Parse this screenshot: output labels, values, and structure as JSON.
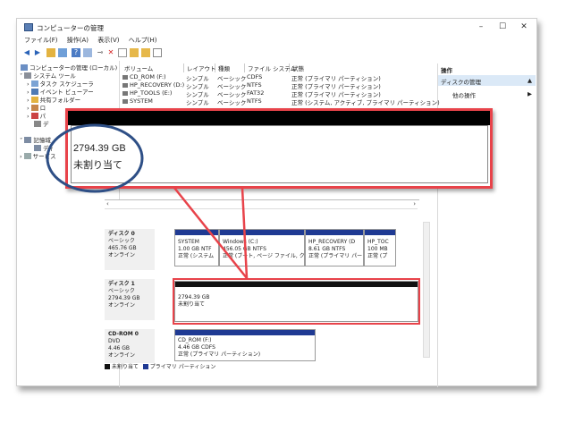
{
  "window": {
    "title": "コンピューターの管理",
    "buttons": [
      "–",
      "☐",
      "✕"
    ]
  },
  "menu": [
    "ファイル(F)",
    "操作(A)",
    "表示(V)",
    "ヘルプ(H)"
  ],
  "tree": [
    {
      "label": "コンピューターの管理 (ローカル)"
    },
    {
      "label": "システム ツール"
    },
    {
      "label": "タスク スケジューラ"
    },
    {
      "label": "イベント ビューアー"
    },
    {
      "label": "共有フォルダー"
    },
    {
      "label": "ロ"
    },
    {
      "label": "パ"
    },
    {
      "label": "デ"
    },
    {
      "label": "記憶域"
    },
    {
      "label": "ディ"
    },
    {
      "label": "サービス"
    }
  ],
  "volume_list": {
    "headers": [
      "ボリューム",
      "レイアウト",
      "種類",
      "ファイル システム",
      "状態"
    ],
    "rows": [
      [
        "CD_ROM (F:)",
        "シンプル",
        "ベーシック",
        "CDFS",
        "正常 (プライマリ パーティション)"
      ],
      [
        "HP_RECOVERY (D:)",
        "シンプル",
        "ベーシック",
        "NTFS",
        "正常 (プライマリ パーティション)"
      ],
      [
        "HP_TOOLS (E:)",
        "シンプル",
        "ベーシック",
        "FAT32",
        "正常 (プライマリ パーティション)"
      ],
      [
        "SYSTEM",
        "シンプル",
        "ベーシック",
        "NTFS",
        "正常 (システム, アクティブ, プライマリ パーティション)"
      ]
    ]
  },
  "actions": {
    "title": "操作",
    "section": "ディスクの管理",
    "other": "他の操作"
  },
  "zoom": {
    "size": "2794.39 GB",
    "status": "未割り当て"
  },
  "disks": [
    {
      "name": "ディスク 0",
      "type": "ベーシック",
      "size": "465.76 GB",
      "state": "オンライン",
      "parts": [
        {
          "name": "SYSTEM",
          "size": "1.00 GB NTF",
          "status": "正常 (システム"
        },
        {
          "name": "Windows (C:)",
          "size": "456.05 GB NTFS",
          "status": "正常 (ブート, ページ ファイル, ク"
        },
        {
          "name": "HP_RECOVERY (D",
          "size": "8.61 GB NTFS",
          "status": "正常 (プライマリ パー"
        },
        {
          "name": "HP_TOC",
          "size": "100 MB",
          "status": "正常 (プ"
        }
      ]
    },
    {
      "name": "ディスク 1",
      "type": "ベーシック",
      "size": "2794.39 GB",
      "state": "オンライン",
      "parts": [
        {
          "name": "",
          "size": "2794.39 GB",
          "status": "未割り当て"
        }
      ]
    },
    {
      "name": "CD-ROM 0",
      "type": "DVD",
      "size": "4.46 GB",
      "state": "オンライン",
      "parts": [
        {
          "name": "CD_ROM (F:)",
          "size": "4.46 GB CDFS",
          "status": "正常 (プライマリ パーティション)"
        }
      ]
    }
  ],
  "legend": [
    "未割り当て",
    "プライマリ パーティション"
  ]
}
